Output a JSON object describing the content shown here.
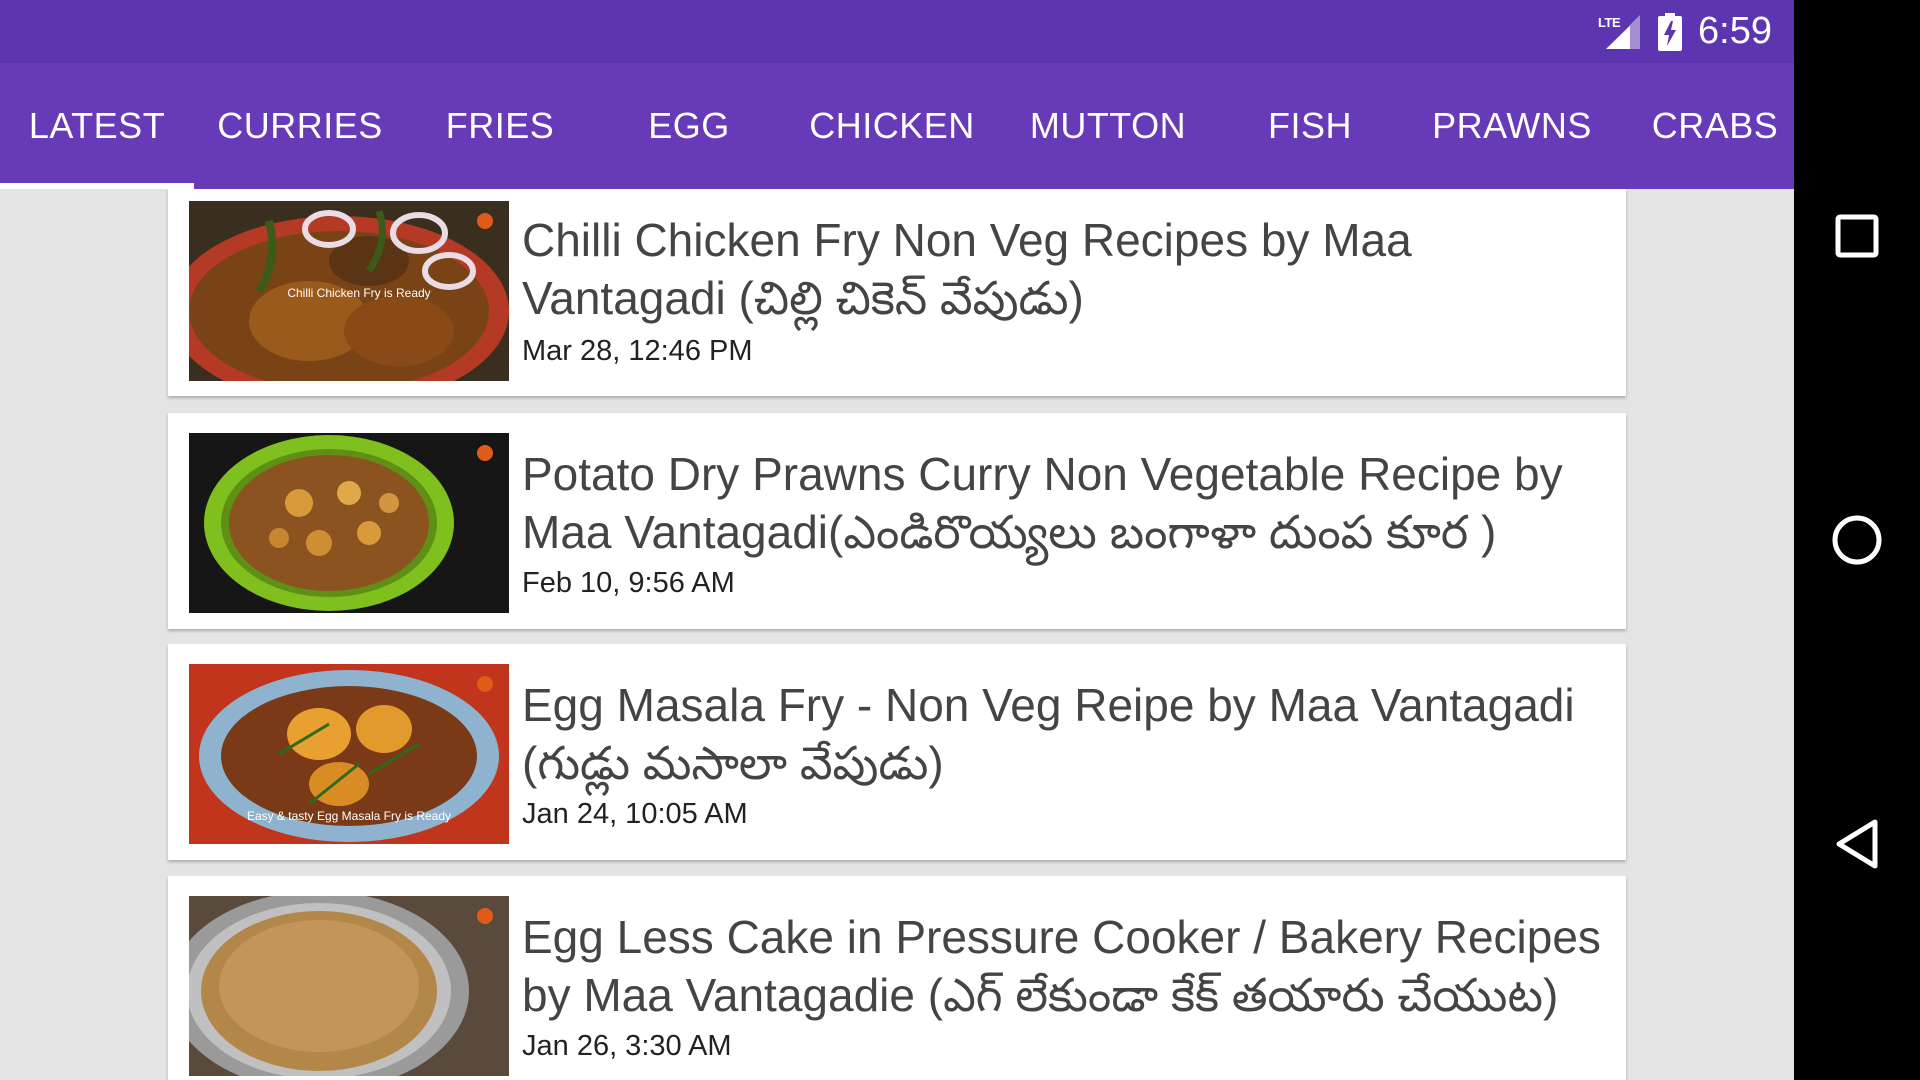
{
  "status_bar": {
    "network_label": "LTE",
    "time": "6:59"
  },
  "tabs": [
    {
      "label": "LATEST",
      "selected": true
    },
    {
      "label": "CURRIES"
    },
    {
      "label": "FRIES"
    },
    {
      "label": "EGG"
    },
    {
      "label": "CHICKEN"
    },
    {
      "label": "MUTTON"
    },
    {
      "label": "FISH"
    },
    {
      "label": "PRAWNS"
    },
    {
      "label": "CRABS"
    }
  ],
  "videos": [
    {
      "title_line1": "Chilli Chicken Fry Non Veg Recipes by Maa",
      "title_line2": "Vantagadi (చిల్లి చికెన్ వేపుడు)",
      "date": "Mar 28, 12:46 PM",
      "thumbnail_caption": "Chilli Chicken Fry is Ready"
    },
    {
      "title_line1": "Potato Dry Prawns Curry Non Vegetable Recipe by",
      "title_line2": "Maa Vantagadi(ఎండిరొయ్యలు బంగాళా దుంప కూర )",
      "date": "Feb 10, 9:56 AM",
      "thumbnail_caption": ""
    },
    {
      "title_line1": "Egg Masala Fry - Non Veg Reipe by Maa Vantagadi",
      "title_line2": "(గుడ్లు మసాలా వేపుడు)",
      "date": "Jan 24, 10:05 AM",
      "thumbnail_caption": "Easy & tasty Egg Masala Fry is Ready"
    },
    {
      "title_line1": "Egg Less Cake in Pressure Cooker / Bakery Recipes",
      "title_line2": "by Maa Vantagadie  (ఎగ్ లేకుండా కేక్ తయారు చేయుట)",
      "date": "Jan 26, 3:30 AM",
      "thumbnail_caption": ""
    }
  ],
  "colors": {
    "status_bar": "#5e35b1",
    "tab_bar": "#673ab7",
    "background": "#e4e4e4",
    "card": "#ffffff",
    "title_text": "#444444"
  },
  "nav_icons": [
    "recents-square-icon",
    "home-circle-icon",
    "back-triangle-icon"
  ]
}
